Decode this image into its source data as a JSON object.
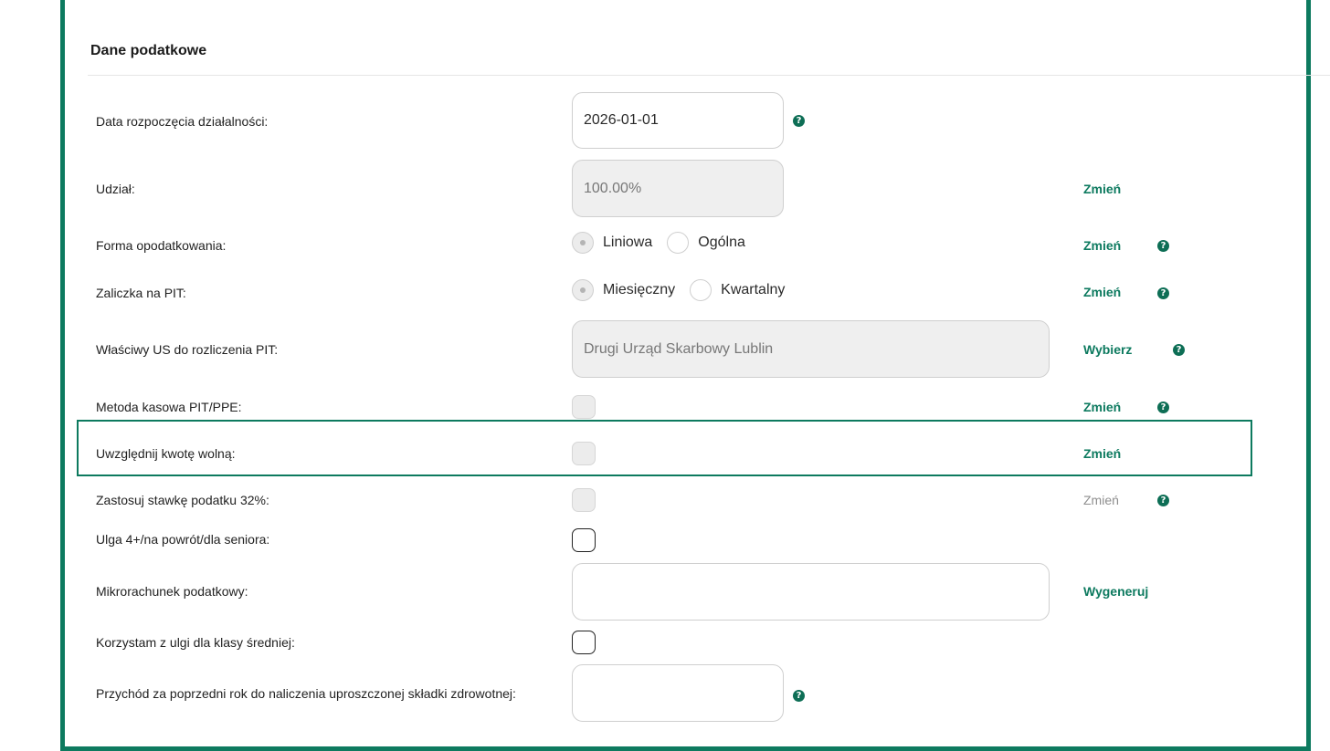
{
  "section": {
    "title": "Dane podatkowe"
  },
  "rows": {
    "start_date": {
      "label": "Data rozpoczęcia działalności:",
      "value": "2026-01-01",
      "help_icon": "question-mark-icon"
    },
    "share": {
      "label": "Udział:",
      "value": "100.00%",
      "action": "Zmień"
    },
    "taxation_form": {
      "label": "Forma opodatkowania:",
      "options": [
        "Liniowa",
        "Ogólna"
      ],
      "selected": "Liniowa",
      "action": "Zmień",
      "help_icon": "question-mark-icon"
    },
    "pit_advance": {
      "label": "Zaliczka na PIT:",
      "options": [
        "Miesięczny",
        "Kwartalny"
      ],
      "selected": "Miesięczny",
      "action": "Zmień",
      "help_icon": "question-mark-icon"
    },
    "tax_office": {
      "label": "Właściwy US do rozliczenia PIT:",
      "value": "Drugi Urząd Skarbowy Lublin",
      "action": "Wybierz",
      "help_icon": "question-mark-icon"
    },
    "cash_method": {
      "label": "Metoda kasowa PIT/PPE:",
      "checked": false,
      "action": "Zmień",
      "help_icon": "question-mark-icon"
    },
    "tax_free_amount": {
      "label": "Uwzględnij kwotę wolną:",
      "checked": false,
      "action": "Zmień"
    },
    "rate_32": {
      "label": "Zastosuj stawkę podatku 32%:",
      "checked": false,
      "action": "Zmień",
      "help_icon": "question-mark-icon"
    },
    "relief_4plus": {
      "label": "Ulga 4+/na powrót/dla seniora:",
      "checked": false
    },
    "micro_account": {
      "label": "Mikrorachunek podatkowy:",
      "value": "",
      "action": "Wygeneruj"
    },
    "middle_class_relief": {
      "label": "Korzystam z ulgi dla klasy średniej:",
      "checked": false
    },
    "previous_year_revenue": {
      "label": "Przychód za poprzedni rok do naliczenia uproszczonej składki zdrowotnej:",
      "value": "",
      "help_icon": "question-mark-icon"
    }
  },
  "help_glyph": "?",
  "colors": {
    "accent": "#0d7a5f",
    "help_icon": "#0d6e55",
    "disabled_field": "#efefef",
    "muted_link": "#8e8e8e"
  }
}
